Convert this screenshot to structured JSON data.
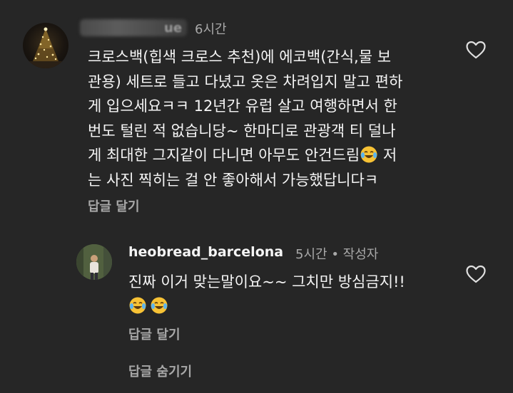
{
  "comment": {
    "username_visible": "ue",
    "time": "6시간",
    "text_lines": [
      "크로스백(힙색 크로스 추천)에 에코백(간식,물 보",
      "관용) 세트로 들고 다녔고 옷은 차려입지 말고 편하",
      "게 입으세요ㅋㅋ 12년간 유럽 살고 여행하면서 한",
      "번도 털린 적 없습니당~ 한마디로 관광객 티 덜나",
      "게 최대한 그지같이 다니면 아무도 안건드림",
      "는 사진 찍히는 걸 안 좋아해서 가능했답니다ㅋ"
    ],
    "line5_tail": " 저",
    "reply_label": "답글 달기",
    "like_icon": "heart-outline-icon"
  },
  "reply": {
    "username": "heobread_barcelona",
    "time": "5시간",
    "separator": "•",
    "author_badge": "작성자",
    "text": "진짜 이거 맞는말이요~~ 그치만 방심금지!!",
    "emoji_name": "face-with-tears-of-joy-icon",
    "reply_label": "답글 달기",
    "hide_label": "답글 숨기기",
    "like_icon": "heart-outline-icon"
  },
  "colors": {
    "background": "#262626",
    "primary_text": "#f5f5f5",
    "secondary_text": "#a8a8a8"
  }
}
